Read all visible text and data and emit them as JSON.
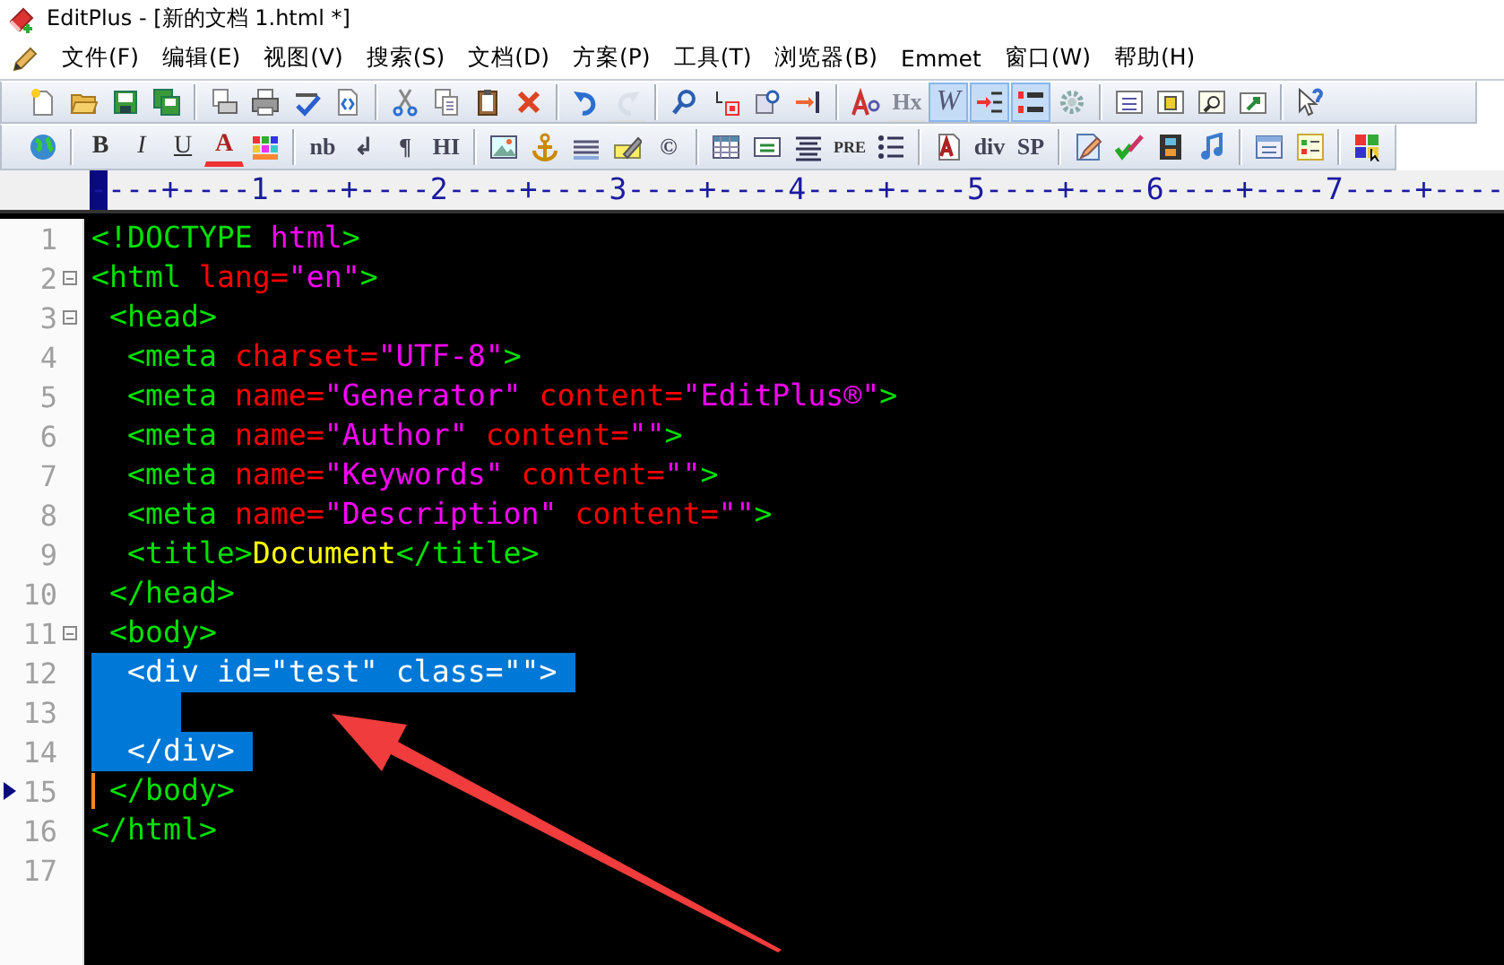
{
  "window": {
    "title": "EditPlus - [新的文档 1.html *]"
  },
  "menu": {
    "items": [
      "文件(F)",
      "编辑(E)",
      "视图(V)",
      "搜索(S)",
      "文档(D)",
      "方案(P)",
      "工具(T)",
      "浏览器(B)",
      "Emmet",
      "窗口(W)",
      "帮助(H)"
    ]
  },
  "toolbars": [
    {
      "buttons": [
        {
          "kind": "icon",
          "disabled": false
        },
        {
          "kind": "icon",
          "disabled": false
        },
        {
          "kind": "icon",
          "disabled": false
        },
        {
          "kind": "icon",
          "disabled": false
        },
        {
          "kind": "separator"
        },
        {
          "kind": "icon",
          "disabled": false
        },
        {
          "kind": "icon",
          "disabled": false
        },
        {
          "kind": "icon",
          "disabled": false
        },
        {
          "kind": "icon",
          "disabled": false
        },
        {
          "kind": "separator"
        },
        {
          "kind": "icon",
          "disabled": false
        },
        {
          "kind": "icon",
          "disabled": false
        },
        {
          "kind": "icon",
          "disabled": false
        },
        {
          "kind": "icon",
          "disabled": false
        },
        {
          "kind": "separator"
        },
        {
          "kind": "icon",
          "disabled": false
        },
        {
          "kind": "icon",
          "disabled": true
        },
        {
          "kind": "separator"
        },
        {
          "kind": "icon",
          "disabled": false
        },
        {
          "kind": "icon",
          "disabled": false
        },
        {
          "kind": "icon",
          "disabled": false
        },
        {
          "kind": "icon",
          "disabled": false
        },
        {
          "kind": "separator"
        },
        {
          "kind": "icon",
          "disabled": false
        },
        {
          "kind": "serif",
          "label": "Hx",
          "disabled": true
        },
        {
          "kind": "italic",
          "label": "W",
          "selected": true,
          "disabled": false
        },
        {
          "kind": "icon",
          "selected": true,
          "disabled": false
        },
        {
          "kind": "icon",
          "selected": true,
          "disabled": false
        },
        {
          "kind": "icon",
          "disabled": false
        },
        {
          "kind": "separator"
        },
        {
          "kind": "icon",
          "disabled": false
        },
        {
          "kind": "icon",
          "disabled": false
        },
        {
          "kind": "icon",
          "disabled": false
        },
        {
          "kind": "icon",
          "disabled": false
        },
        {
          "kind": "separator"
        },
        {
          "kind": "icon",
          "disabled": false
        }
      ]
    },
    {
      "buttons": [
        {
          "kind": "icon",
          "disabled": false
        },
        {
          "kind": "separator"
        },
        {
          "kind": "bold",
          "label": "B",
          "disabled": false
        },
        {
          "kind": "italic",
          "label": "I",
          "disabled": false
        },
        {
          "kind": "underline",
          "label": "U",
          "disabled": false
        },
        {
          "kind": "color",
          "label": "A",
          "disabled": false
        },
        {
          "kind": "icon",
          "disabled": false
        },
        {
          "kind": "separator"
        },
        {
          "kind": "serif",
          "label": "nb",
          "disabled": false
        },
        {
          "kind": "serif",
          "label": "↲",
          "disabled": false
        },
        {
          "kind": "serif",
          "label": "¶",
          "disabled": false
        },
        {
          "kind": "serif",
          "label": "HI",
          "disabled": false
        },
        {
          "kind": "separator"
        },
        {
          "kind": "icon",
          "disabled": false
        },
        {
          "kind": "icon",
          "disabled": false
        },
        {
          "kind": "icon",
          "disabled": false
        },
        {
          "kind": "icon",
          "disabled": false
        },
        {
          "kind": "serif",
          "label": "©",
          "disabled": false
        },
        {
          "kind": "separator"
        },
        {
          "kind": "icon",
          "disabled": false
        },
        {
          "kind": "icon",
          "disabled": false
        },
        {
          "kind": "icon",
          "disabled": false
        },
        {
          "kind": "small",
          "label": "PRE",
          "disabled": false
        },
        {
          "kind": "icon",
          "disabled": false
        },
        {
          "kind": "separator"
        },
        {
          "kind": "icon",
          "disabled": false
        },
        {
          "kind": "serif",
          "label": "div",
          "disabled": false
        },
        {
          "kind": "serif",
          "label": "SP",
          "disabled": false
        },
        {
          "kind": "separator"
        },
        {
          "kind": "icon",
          "disabled": false
        },
        {
          "kind": "icon",
          "disabled": false
        },
        {
          "kind": "icon",
          "disabled": false
        },
        {
          "kind": "icon",
          "disabled": false
        },
        {
          "kind": "separator"
        },
        {
          "kind": "icon",
          "disabled": false
        },
        {
          "kind": "icon",
          "disabled": false
        },
        {
          "kind": "separator"
        },
        {
          "kind": "icon",
          "disabled": false
        }
      ]
    }
  ],
  "ruler": {
    "text": "----+----1----+----2----+----3----+----4----+----5----+----6----+----7----+----"
  },
  "lines": [
    {
      "number": "1",
      "fold": false,
      "bookmark": false,
      "current": false,
      "selected": false,
      "tokens": [
        {
          "kind": "tag",
          "text": "<!DOCTYPE "
        },
        {
          "kind": "value",
          "text": "html"
        },
        {
          "kind": "tag",
          "text": ">"
        }
      ]
    },
    {
      "number": "2",
      "fold": true,
      "bookmark": false,
      "current": false,
      "selected": false,
      "tokens": [
        {
          "kind": "tag",
          "text": "<html "
        },
        {
          "kind": "attr",
          "text": "lang="
        },
        {
          "kind": "value",
          "text": "\"en\""
        },
        {
          "kind": "tag",
          "text": ">"
        }
      ]
    },
    {
      "number": "3",
      "fold": true,
      "bookmark": false,
      "current": false,
      "selected": false,
      "tokens": [
        {
          "kind": "tag",
          "text": " <head>"
        }
      ]
    },
    {
      "number": "4",
      "fold": false,
      "bookmark": false,
      "current": false,
      "selected": false,
      "tokens": [
        {
          "kind": "tag",
          "text": "  <meta "
        },
        {
          "kind": "attr",
          "text": "charset="
        },
        {
          "kind": "value",
          "text": "\"UTF-8\""
        },
        {
          "kind": "tag",
          "text": ">"
        }
      ]
    },
    {
      "number": "5",
      "fold": false,
      "bookmark": false,
      "current": false,
      "selected": false,
      "tokens": [
        {
          "kind": "tag",
          "text": "  <meta "
        },
        {
          "kind": "attr",
          "text": "name="
        },
        {
          "kind": "value",
          "text": "\"Generator\" "
        },
        {
          "kind": "attr",
          "text": "content="
        },
        {
          "kind": "value",
          "text": "\"EditPlus®\""
        },
        {
          "kind": "tag",
          "text": ">"
        }
      ]
    },
    {
      "number": "6",
      "fold": false,
      "bookmark": false,
      "current": false,
      "selected": false,
      "tokens": [
        {
          "kind": "tag",
          "text": "  <meta "
        },
        {
          "kind": "attr",
          "text": "name="
        },
        {
          "kind": "value",
          "text": "\"Author\" "
        },
        {
          "kind": "attr",
          "text": "content="
        },
        {
          "kind": "value",
          "text": "\"\""
        },
        {
          "kind": "tag",
          "text": ">"
        }
      ]
    },
    {
      "number": "7",
      "fold": false,
      "bookmark": false,
      "current": false,
      "selected": false,
      "tokens": [
        {
          "kind": "tag",
          "text": "  <meta "
        },
        {
          "kind": "attr",
          "text": "name="
        },
        {
          "kind": "value",
          "text": "\"Keywords\" "
        },
        {
          "kind": "attr",
          "text": "content="
        },
        {
          "kind": "value",
          "text": "\"\""
        },
        {
          "kind": "tag",
          "text": ">"
        }
      ]
    },
    {
      "number": "8",
      "fold": false,
      "bookmark": false,
      "current": false,
      "selected": false,
      "tokens": [
        {
          "kind": "tag",
          "text": "  <meta "
        },
        {
          "kind": "attr",
          "text": "name="
        },
        {
          "kind": "value",
          "text": "\"Description\" "
        },
        {
          "kind": "attr",
          "text": "content="
        },
        {
          "kind": "value",
          "text": "\"\""
        },
        {
          "kind": "tag",
          "text": ">"
        }
      ]
    },
    {
      "number": "9",
      "fold": false,
      "bookmark": false,
      "current": false,
      "selected": false,
      "tokens": [
        {
          "kind": "tag",
          "text": "  <title>"
        },
        {
          "kind": "text",
          "text": "Document"
        },
        {
          "kind": "tag",
          "text": "</title>"
        }
      ]
    },
    {
      "number": "10",
      "fold": false,
      "bookmark": false,
      "current": false,
      "selected": false,
      "tokens": [
        {
          "kind": "tag",
          "text": " </head>"
        }
      ]
    },
    {
      "number": "11",
      "fold": true,
      "bookmark": false,
      "current": false,
      "selected": false,
      "tokens": [
        {
          "kind": "tag",
          "text": " <body>"
        }
      ]
    },
    {
      "number": "12",
      "fold": false,
      "bookmark": false,
      "current": false,
      "selected": true,
      "tokens": [
        {
          "kind": "tag",
          "text": "  <div "
        },
        {
          "kind": "attr",
          "text": "id="
        },
        {
          "kind": "value",
          "text": "\"test\" "
        },
        {
          "kind": "attr",
          "text": "class="
        },
        {
          "kind": "value",
          "text": "\"\""
        },
        {
          "kind": "tag",
          "text": ">"
        }
      ]
    },
    {
      "number": "13",
      "fold": false,
      "bookmark": false,
      "current": false,
      "selected": true
    },
    {
      "number": "14",
      "fold": false,
      "bookmark": false,
      "current": false,
      "selected": true,
      "tokens": [
        {
          "kind": "tag",
          "text": "  </div>"
        }
      ]
    },
    {
      "number": "15",
      "fold": false,
      "bookmark": true,
      "current": true,
      "selected": false,
      "tokens": [
        {
          "kind": "tag",
          "text": " </body>"
        }
      ]
    },
    {
      "number": "16",
      "fold": false,
      "bookmark": false,
      "current": false,
      "selected": false,
      "tokens": [
        {
          "kind": "tag",
          "text": "</html>"
        }
      ]
    },
    {
      "number": "17",
      "fold": false,
      "bookmark": false,
      "current": false,
      "selected": false
    }
  ]
}
